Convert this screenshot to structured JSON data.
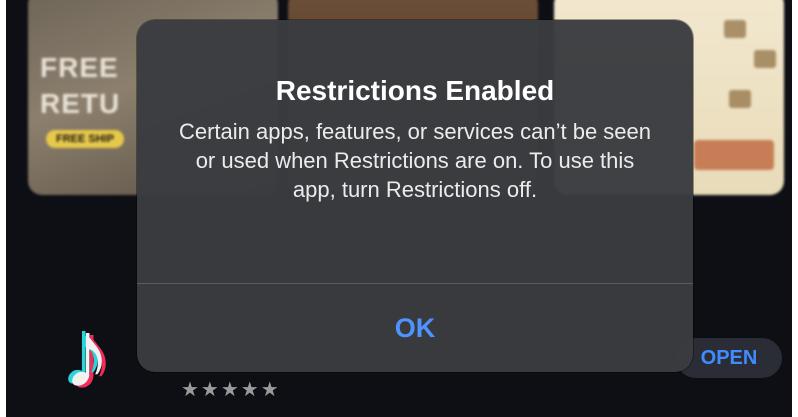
{
  "background": {
    "promo_left": {
      "line1": "FREE",
      "line2": "RETU",
      "badge": "FREE SHIP"
    },
    "app": {
      "icon": "tiktok-logo-icon",
      "stars": "★★★★★",
      "open_label": "OPEN"
    }
  },
  "alert": {
    "title": "Restrictions Enabled",
    "message": "Certain apps, features, or services can’t be seen or used when Restrictions are on. To use this app, turn Restrictions off.",
    "ok_label": "OK"
  },
  "colors": {
    "alert_background": "#3a3c40",
    "button_blue": "#4f93ff"
  }
}
